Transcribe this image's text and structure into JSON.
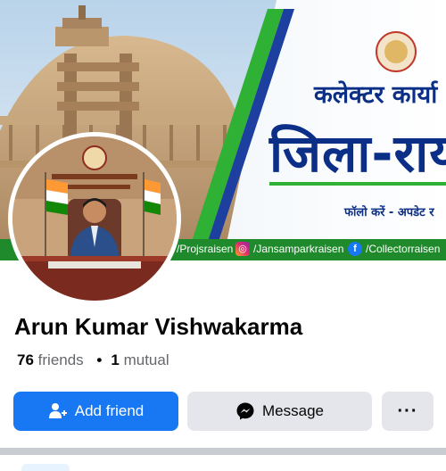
{
  "cover": {
    "line1": "कलेक्टर कार्या",
    "line2": "जिला-राय",
    "line3": "फॉलो करें - अपडेट र",
    "social": [
      {
        "icon": "instagram-icon",
        "text": "/Projsraisen"
      },
      {
        "icon": "instagram-icon",
        "text": "/Jansamparkraisen"
      },
      {
        "icon": "facebook-icon",
        "text": "/Collectorraisen"
      }
    ],
    "colors": {
      "strip": "#1f8a2b",
      "heading": "#0b2f86"
    }
  },
  "profile": {
    "name": "Arun Kumar Vishwakarma",
    "friends_count": "76",
    "friends_label": "friends",
    "separator": "•",
    "mutual_count": "1",
    "mutual_label": "mutual"
  },
  "actions": {
    "add_friend": "Add friend",
    "message": "Message",
    "more": "···"
  },
  "theme": {
    "primary": "#1877f2",
    "secondary_bg": "#e4e6eb"
  }
}
